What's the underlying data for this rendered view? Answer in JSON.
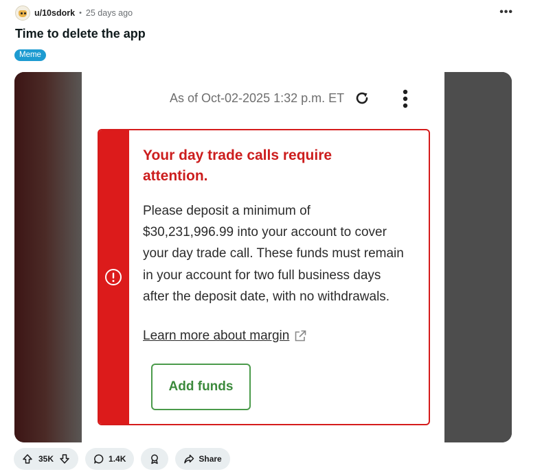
{
  "post": {
    "author": "u/10sdork",
    "separator": "•",
    "time_ago": "25 days ago",
    "more_label": "•••",
    "title": "Time to delete the app",
    "flair": "Meme",
    "flair_color": "#1d9bd1"
  },
  "screenshot": {
    "as_of": "As of Oct-02-2025 1:32 p.m. ET",
    "alert_heading": "Your day trade calls require attention.",
    "alert_body": "Please deposit a minimum of $30,231,996.99 into your account to cover your day trade call. These funds must remain in your account for two full business days after the deposit date, with no withdrawals.",
    "learn_link": "Learn more about margin",
    "add_funds_label": "Add funds",
    "alert_color": "#dc1b1b",
    "button_color": "#3c8a3c"
  },
  "actions": {
    "votes": "35K",
    "comments": "1.4K",
    "share_label": "Share"
  },
  "icons": {
    "upvote": "arrow-up-icon",
    "downvote": "arrow-down-icon",
    "comment": "speech-bubble-icon",
    "award": "award-icon",
    "share": "share-arrow-icon",
    "refresh": "refresh-icon",
    "kebab": "vertical-dots-icon",
    "alert": "exclamation-circle-icon",
    "external": "external-link-icon"
  }
}
